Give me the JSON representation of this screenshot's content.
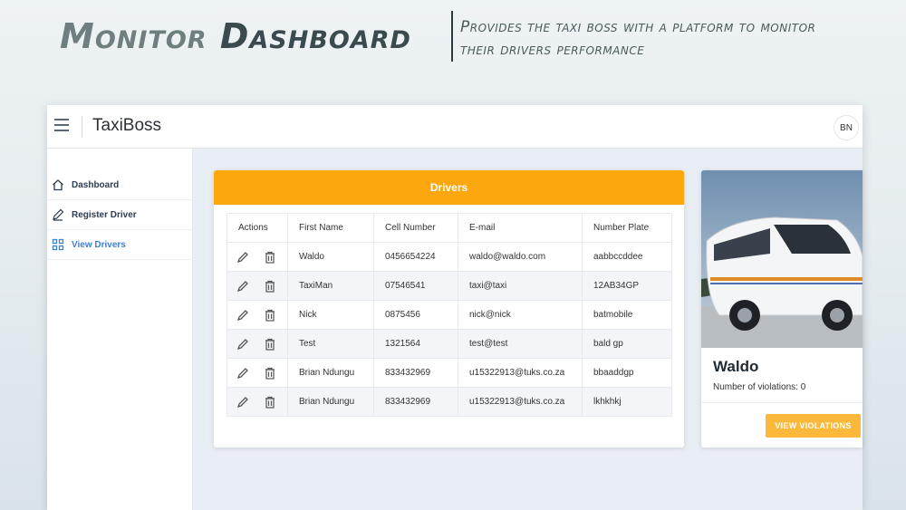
{
  "headline": {
    "title_part1": "Monitor",
    "title_part2": "Dashboard",
    "subtitle": "Provides the taxi boss with a platform to monitor their drivers performance"
  },
  "app": {
    "brand": "TaxiBoss",
    "user_initials": "BN"
  },
  "sidebar": {
    "items": [
      {
        "label": "Dashboard",
        "icon": "home-icon"
      },
      {
        "label": "Register Driver",
        "icon": "pencil-icon"
      },
      {
        "label": "View Drivers",
        "icon": "grid-icon",
        "active": true
      }
    ]
  },
  "drivers": {
    "title": "Drivers",
    "columns": [
      "Actions",
      "First Name",
      "Cell Number",
      "E-mail",
      "Number Plate"
    ],
    "rows": [
      {
        "first_name": "Waldo",
        "cell": "0456654224",
        "email": "waldo@waldo.com",
        "plate": "aabbccddee"
      },
      {
        "first_name": "TaxiMan",
        "cell": "07546541",
        "email": "taxi@taxi",
        "plate": "12AB34GP"
      },
      {
        "first_name": "Nick",
        "cell": "0875456",
        "email": "nick@nick",
        "plate": "batmobile"
      },
      {
        "first_name": "Test",
        "cell": "1321564",
        "email": "test@test",
        "plate": "bald gp"
      },
      {
        "first_name": "Brian Ndungu",
        "cell": "833432969",
        "email": "u15322913@tuks.co.za",
        "plate": "bbaaddgp"
      },
      {
        "first_name": "Brian Ndungu",
        "cell": "833432969",
        "email": "u15322913@tuks.co.za",
        "plate": "lkhkhkj"
      }
    ]
  },
  "profile": {
    "name": "Waldo",
    "violations_text": "Number of violations: 0",
    "button_label": "VIEW VIOLATIONS"
  },
  "colors": {
    "accent": "#fba70d",
    "button": "#fbb83a",
    "active_nav": "#3f7fd0"
  }
}
